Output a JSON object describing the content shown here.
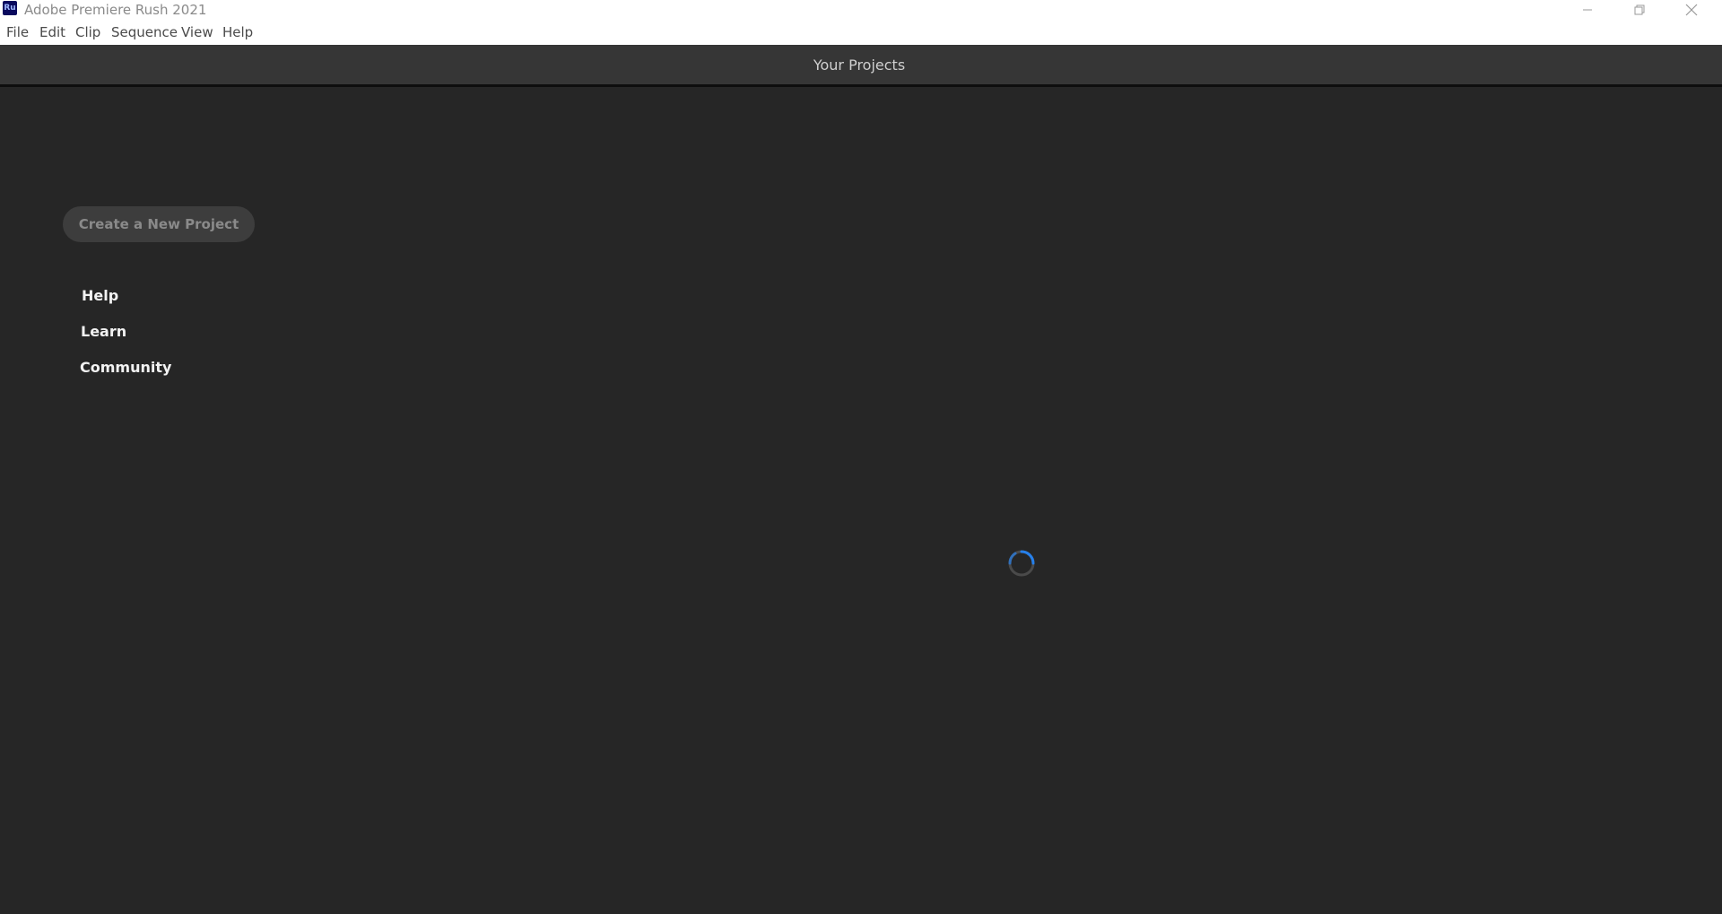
{
  "window": {
    "app_icon_text": "Ru",
    "title": "Adobe Premiere Rush 2021",
    "controls": [
      "minimize-icon",
      "restore-icon",
      "close-icon"
    ]
  },
  "menu": {
    "items": [
      "File",
      "Edit",
      "Clip",
      "Sequence",
      "View",
      "Help"
    ]
  },
  "header": {
    "title": "Your Projects"
  },
  "sidebar": {
    "create_label": "Create a New Project",
    "links": [
      "Help",
      "Learn",
      "Community"
    ]
  },
  "main": {
    "loading_icon": "loading-spinner-icon"
  },
  "colors": {
    "background": "#262626",
    "header": "#363636",
    "accent": "#2680eb"
  }
}
